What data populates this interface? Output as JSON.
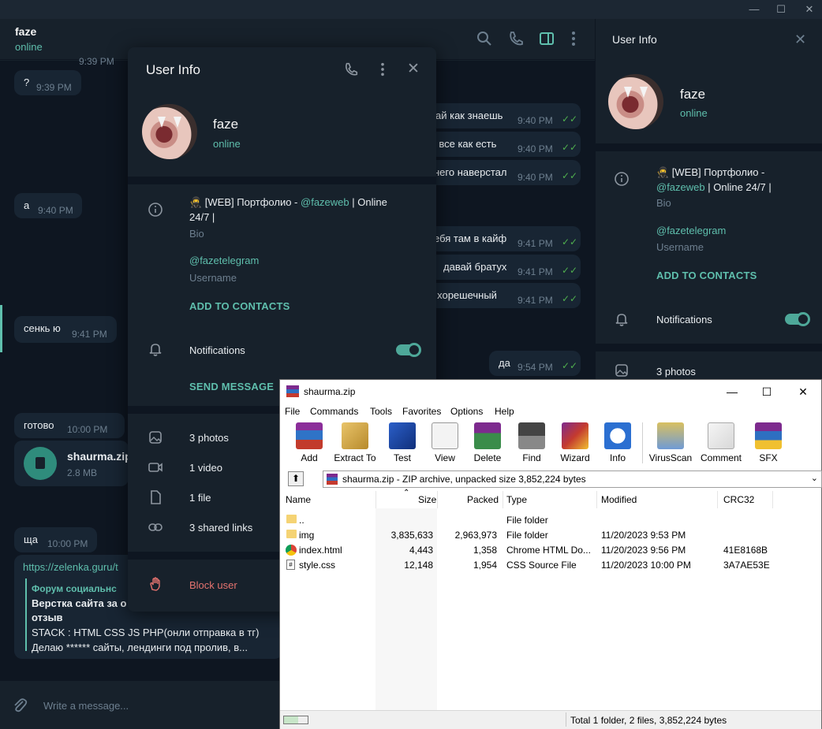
{
  "telegram": {
    "window_controls": [
      "—",
      "☐",
      "✕"
    ],
    "header": {
      "name": "faze",
      "status": "online"
    },
    "messages_in": [
      {
        "text": "?",
        "time": "9:39 PM"
      },
      {
        "text": "а",
        "time": "9:40 PM"
      },
      {
        "text": "сенкь ю",
        "time": "9:41 PM"
      },
      {
        "text": "готово",
        "time": "10:00 PM"
      },
      {
        "text": "ща",
        "time": "10:00 PM"
      }
    ],
    "messages_out": [
      {
        "text": "ай как знаешь",
        "time": "9:40 PM"
      },
      {
        "text": "ть все как есть",
        "time": "9:40 PM"
      },
      {
        "text": "него наверстал",
        "time": "9:40 PM"
      },
      {
        "text": "ебя там в кайф",
        "time": "9:41 PM"
      },
      {
        "text": "давай братух",
        "time": "9:41 PM"
      },
      {
        "text": "у хорешечный",
        "time": "9:41 PM"
      },
      {
        "text": "да",
        "time": "9:54 PM"
      }
    ],
    "top_time_fragment": "9:39 PM",
    "file_message": {
      "name": "shaurma.zip",
      "size": "2.8 MB"
    },
    "link_preview": {
      "url": "https://zelenka.guru/t",
      "site": "Форум социальнс",
      "title": "Верстка сайта за о",
      "title2": "отзыв",
      "line1": "STACK : HTML CSS JS PHP(онли отправка в тг)",
      "line2": "Делаю ****** сайты, лендинги под пролив, в..."
    },
    "compose_placeholder": "Write a message...",
    "right_panel": {
      "title": "User Info",
      "name": "faze",
      "status": "online",
      "bio_part1": "🥷 [WEB] Портфолио -",
      "bio_link": "@fazeweb",
      "bio_part2": "| Online 24/7 |",
      "bio_label": "Bio",
      "username": "@fazetelegram",
      "username_label": "Username",
      "add_contacts": "ADD TO CONTACTS",
      "notifications": "Notifications",
      "photos": "3 photos"
    },
    "popup": {
      "title": "User Info",
      "name": "faze",
      "status": "online",
      "bio_part1": "🥷 [WEB] Портфолио -",
      "bio_link": "@fazeweb",
      "bio_part2": "| Online",
      "bio_part3": "24/7 |",
      "bio_label": "Bio",
      "username": "@fazetelegram",
      "username_label": "Username",
      "add_contacts": "ADD TO CONTACTS",
      "notifications": "Notifications",
      "notifications_on": true,
      "send_message": "SEND MESSAGE",
      "media": [
        {
          "icon": "photo-icon",
          "label": "3 photos"
        },
        {
          "icon": "video-icon",
          "label": "1 video"
        },
        {
          "icon": "file-icon",
          "label": "1 file"
        },
        {
          "icon": "link-icon",
          "label": "3 shared links"
        }
      ],
      "block_user": "Block user"
    },
    "colors": {
      "accent": "#5fbfad",
      "danger": "#e5736f",
      "bg": "#17212b",
      "chat_bg": "#0e1621"
    }
  },
  "winrar": {
    "title": "shaurma.zip",
    "window_controls": [
      "—",
      "☐",
      "✕"
    ],
    "menu": [
      "File",
      "Commands",
      "Tools",
      "Favorites",
      "Options",
      "Help"
    ],
    "toolbar": [
      {
        "label": "Add",
        "icon": "add-archive-icon"
      },
      {
        "label": "Extract To",
        "icon": "extract-icon"
      },
      {
        "label": "Test",
        "icon": "test-icon"
      },
      {
        "label": "View",
        "icon": "view-icon"
      },
      {
        "label": "Delete",
        "icon": "delete-icon"
      },
      {
        "label": "Find",
        "icon": "find-icon"
      },
      {
        "label": "Wizard",
        "icon": "wizard-icon"
      },
      {
        "label": "Info",
        "icon": "info-icon"
      },
      {
        "label": "VirusScan",
        "icon": "virusscan-icon"
      },
      {
        "label": "Comment",
        "icon": "comment-icon"
      },
      {
        "label": "SFX",
        "icon": "sfx-icon"
      }
    ],
    "address": "shaurma.zip - ZIP archive, unpacked size 3,852,224 bytes",
    "columns": [
      "Name",
      "Size",
      "Packed",
      "Type",
      "Modified",
      "CRC32"
    ],
    "rows": [
      {
        "name": "..",
        "size": "",
        "packed": "",
        "type": "File folder",
        "modified": "",
        "crc": ""
      },
      {
        "name": "img",
        "size": "3,835,633",
        "packed": "2,963,973",
        "type": "File folder",
        "modified": "11/20/2023 9:53 PM",
        "crc": ""
      },
      {
        "name": "index.html",
        "size": "4,443",
        "packed": "1,358",
        "type": "Chrome HTML Do...",
        "modified": "11/20/2023 9:56 PM",
        "crc": "41E8168B"
      },
      {
        "name": "style.css",
        "size": "12,148",
        "packed": "1,954",
        "type": "CSS Source File",
        "modified": "11/20/2023 10:00 PM",
        "crc": "3A7AE53E"
      }
    ],
    "status": "Total 1 folder, 2 files, 3,852,224 bytes"
  }
}
